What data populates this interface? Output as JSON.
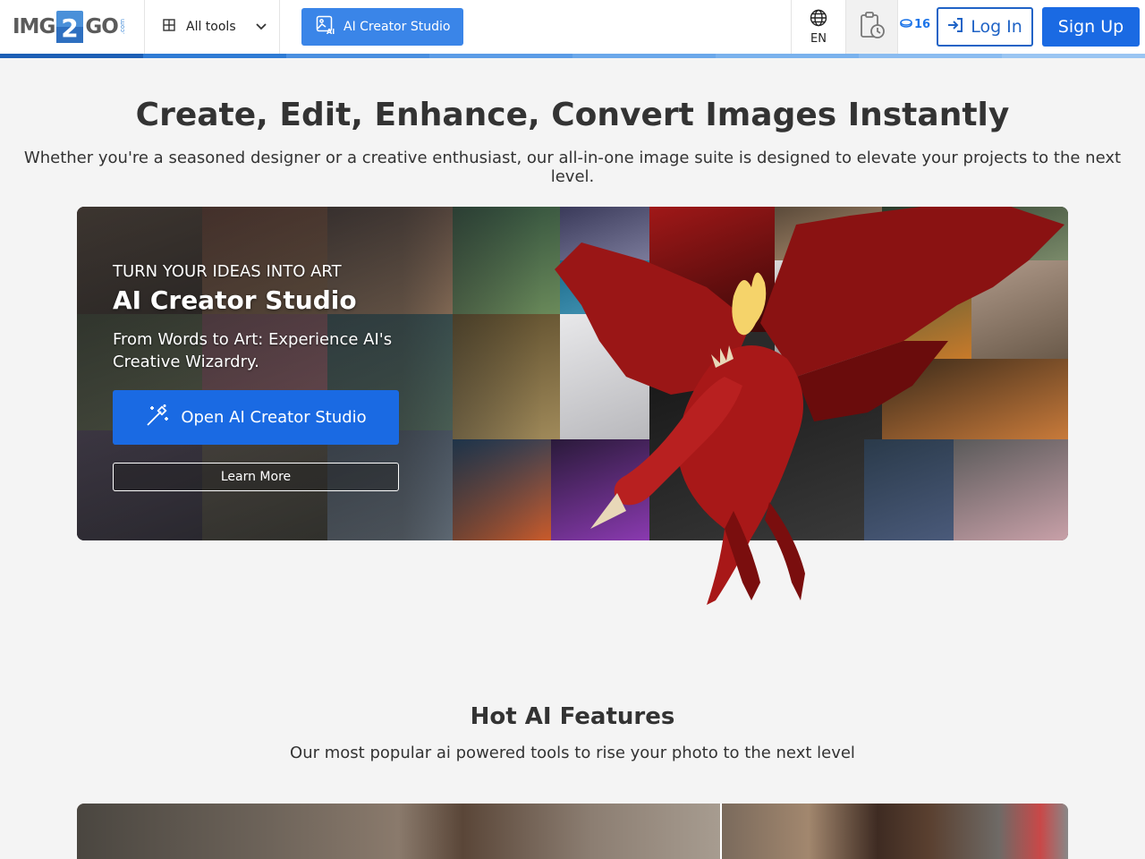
{
  "header": {
    "logo": {
      "left": "IMG",
      "middle": "2",
      "right": "GO",
      "suffix": ".com"
    },
    "all_tools_label": "All tools",
    "ai_studio_label": "AI Creator Studio",
    "language": "EN",
    "credits": "16",
    "login_label": "Log In",
    "signup_label": "Sign Up"
  },
  "hero": {
    "title": "Create, Edit, Enhance, Convert Images Instantly",
    "subtitle": "Whether you're a seasoned designer or a creative enthusiast, our all-in-one image suite is designed to elevate your projects to the next level."
  },
  "banner": {
    "kicker": "TURN YOUR IDEAS INTO ART",
    "title": "AI Creator Studio",
    "description": "From Words to Art: Experience AI's Creative Wizardry.",
    "open_button": "Open AI Creator Studio",
    "learn_button": "Learn More"
  },
  "features": {
    "title": "Hot AI Features",
    "subtitle": "Our most popular ai powered tools to rise your photo to the next level"
  },
  "colors": {
    "primary": "#1a6ae3",
    "ai_button": "#3a85e8",
    "login_border": "#1f63c6",
    "background": "#f4f4f4"
  },
  "icons": [
    "grid-icon",
    "chevron-down-icon",
    "ai-image-icon",
    "globe-icon",
    "clipboard-history-icon",
    "credits-icon",
    "login-arrow-icon",
    "magic-wand-icon"
  ]
}
